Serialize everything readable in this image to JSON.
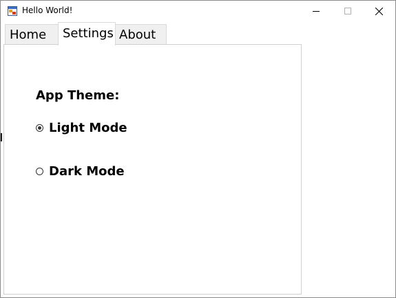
{
  "window": {
    "title": "Hello World!",
    "icons": {
      "app": "app-window-icon",
      "minimize": "minimize-icon",
      "maximize": "maximize-icon",
      "close": "close-icon"
    }
  },
  "tabs": [
    {
      "label": "Home",
      "selected": false
    },
    {
      "label": "Settings",
      "selected": true
    },
    {
      "label": "About",
      "selected": false
    }
  ],
  "settings": {
    "section_label": "App Theme:",
    "options": [
      {
        "label": "Light Mode",
        "checked": true
      },
      {
        "label": "Dark Mode",
        "checked": false
      }
    ]
  },
  "colors": {
    "window_bg": "#ffffff",
    "tab_bg": "#f0f0f0",
    "selected_tab_bg": "#ffffff",
    "border": "#d0d0d0",
    "text": "#000000"
  }
}
